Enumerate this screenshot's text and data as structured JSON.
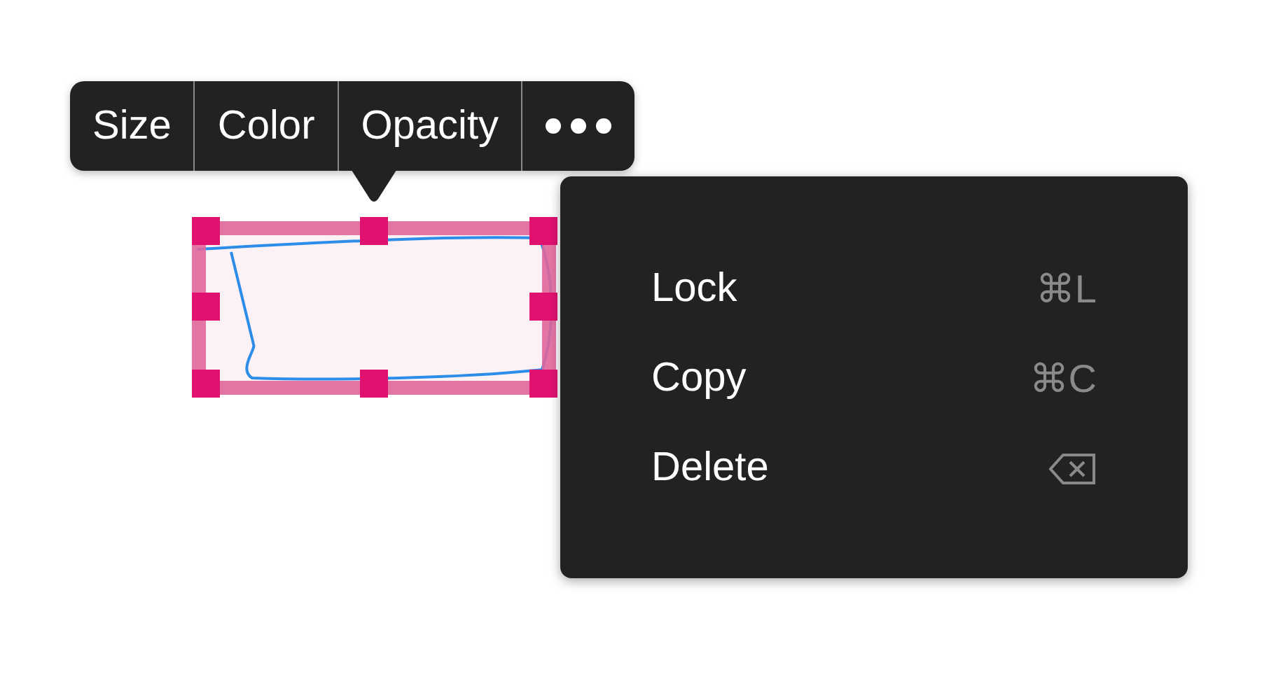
{
  "toolbar": {
    "items": [
      {
        "kind": "text",
        "label": "Size"
      },
      {
        "kind": "text",
        "label": "Color"
      },
      {
        "kind": "text",
        "label": "Opacity"
      },
      {
        "kind": "more"
      }
    ]
  },
  "context_menu": {
    "items": [
      {
        "label": "Lock",
        "kind": "text",
        "shortcut": "⌘L"
      },
      {
        "label": "Copy",
        "kind": "text",
        "shortcut": "⌘C"
      },
      {
        "label": "Delete",
        "kind": "delete-key"
      }
    ]
  }
}
